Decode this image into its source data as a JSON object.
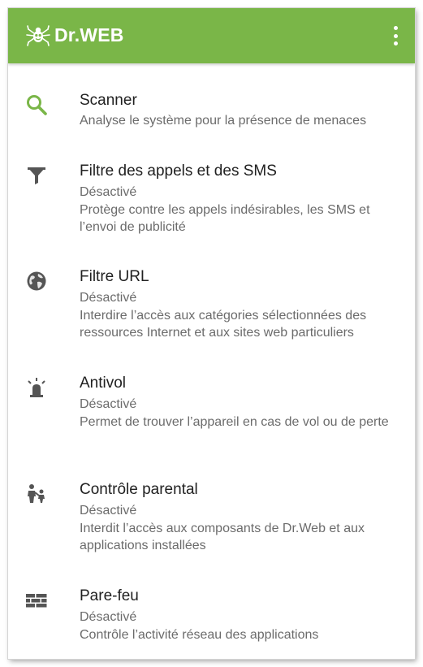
{
  "app": {
    "brand": "Dr.WEB",
    "accent_color": "#7ab648",
    "menu_icon": "more-vert-icon"
  },
  "items": [
    {
      "icon": "search-icon",
      "title": "Scanner",
      "status": "",
      "description": "Analyse le système pour la présence de menaces"
    },
    {
      "icon": "filter-icon",
      "title": "Filtre des appels et des SMS",
      "status": "Désactivé",
      "description": "Protège contre les appels indésirables, les SMS et l’envoi de publicité"
    },
    {
      "icon": "globe-icon",
      "title": "Filtre URL",
      "status": "Désactivé",
      "description": "Interdire l’accès aux catégories sélectionnées des ressources Internet et aux sites web particuliers"
    },
    {
      "icon": "alarm-light-icon",
      "title": "Antivol",
      "status": "Désactivé",
      "description": "Permet de trouver l’appareil en cas de vol ou de perte"
    },
    {
      "icon": "parent-child-icon",
      "title": "Contrôle parental",
      "status": "Désactivé",
      "description": "Interdit l’accès aux composants de Dr.Web et aux applications installées"
    },
    {
      "icon": "firewall-icon",
      "title": "Pare-feu",
      "status": "Désactivé",
      "description": "Contrôle l’activité réseau des applications"
    }
  ]
}
